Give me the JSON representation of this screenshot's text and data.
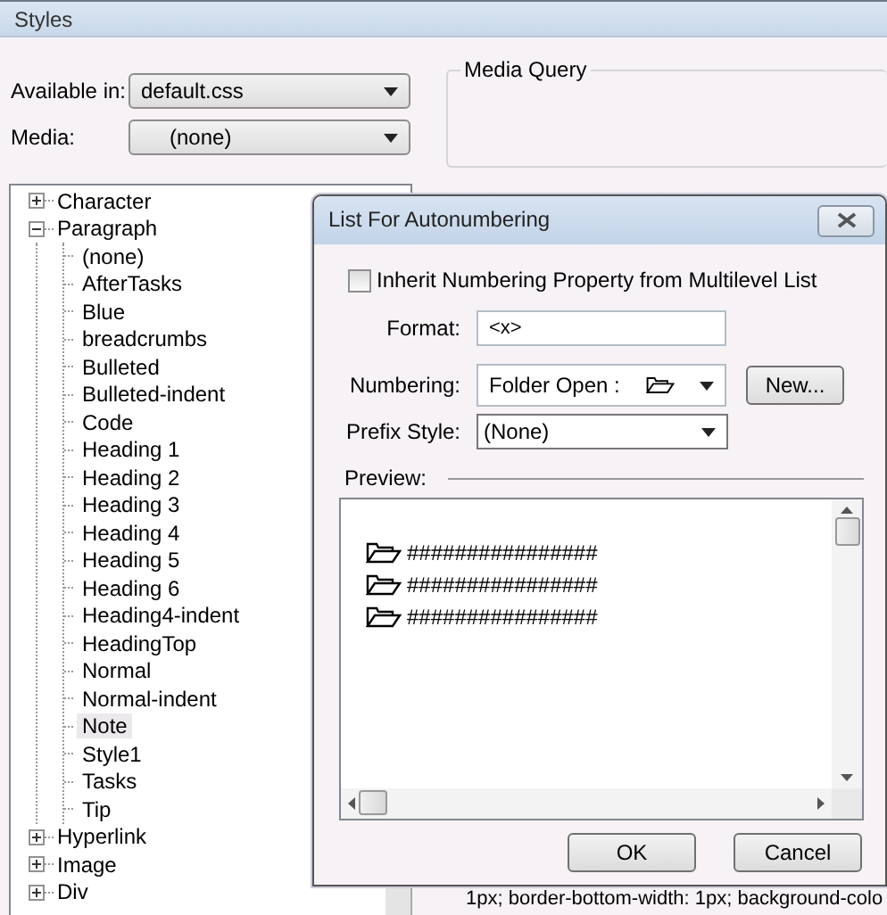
{
  "window": {
    "title": "Styles"
  },
  "available_in": {
    "label": "Available in:",
    "value": "default.css"
  },
  "media": {
    "label": "Media:",
    "value": "(none)"
  },
  "media_query": {
    "label": "Media Query"
  },
  "tree": [
    {
      "label": "Character",
      "expanded": false
    },
    {
      "label": "Paragraph",
      "expanded": true,
      "children": [
        {
          "label": "(none)",
          "selected": false
        },
        {
          "label": "AfterTasks",
          "selected": false
        },
        {
          "label": "Blue",
          "selected": false
        },
        {
          "label": "breadcrumbs",
          "selected": false
        },
        {
          "label": "Bulleted",
          "selected": false
        },
        {
          "label": "Bulleted-indent",
          "selected": false
        },
        {
          "label": "Code",
          "selected": false
        },
        {
          "label": "Heading 1",
          "selected": false
        },
        {
          "label": "Heading 2",
          "selected": false
        },
        {
          "label": "Heading 3",
          "selected": false
        },
        {
          "label": "Heading 4",
          "selected": false
        },
        {
          "label": "Heading 5",
          "selected": false
        },
        {
          "label": "Heading 6",
          "selected": false
        },
        {
          "label": "Heading4-indent",
          "selected": false
        },
        {
          "label": "HeadingTop",
          "selected": false
        },
        {
          "label": "Normal",
          "selected": false
        },
        {
          "label": "Normal-indent",
          "selected": false
        },
        {
          "label": "Note",
          "selected": true
        },
        {
          "label": "Style1",
          "selected": false
        },
        {
          "label": "Tasks",
          "selected": false
        },
        {
          "label": "Tip",
          "selected": false
        }
      ]
    },
    {
      "label": "Hyperlink",
      "expanded": false
    },
    {
      "label": "Image",
      "expanded": false
    },
    {
      "label": "Div",
      "expanded": false
    }
  ],
  "properties_text": "1px; border-bottom-width: 1px; background-colo",
  "dialog": {
    "title": "List For Autonumbering",
    "inherit": {
      "label": "Inherit Numbering Property from Multilevel List",
      "checked": false
    },
    "format": {
      "label": "Format:",
      "value": "<x>"
    },
    "numbering": {
      "label": "Numbering:",
      "value": "Folder Open :"
    },
    "new_button": "New...",
    "prefix_style": {
      "label": "Prefix Style:",
      "value": "(None)"
    },
    "preview": {
      "label": "Preview:",
      "lines": [
        "################",
        "################",
        "################"
      ]
    },
    "buttons": [
      "OK",
      "Cancel"
    ]
  }
}
